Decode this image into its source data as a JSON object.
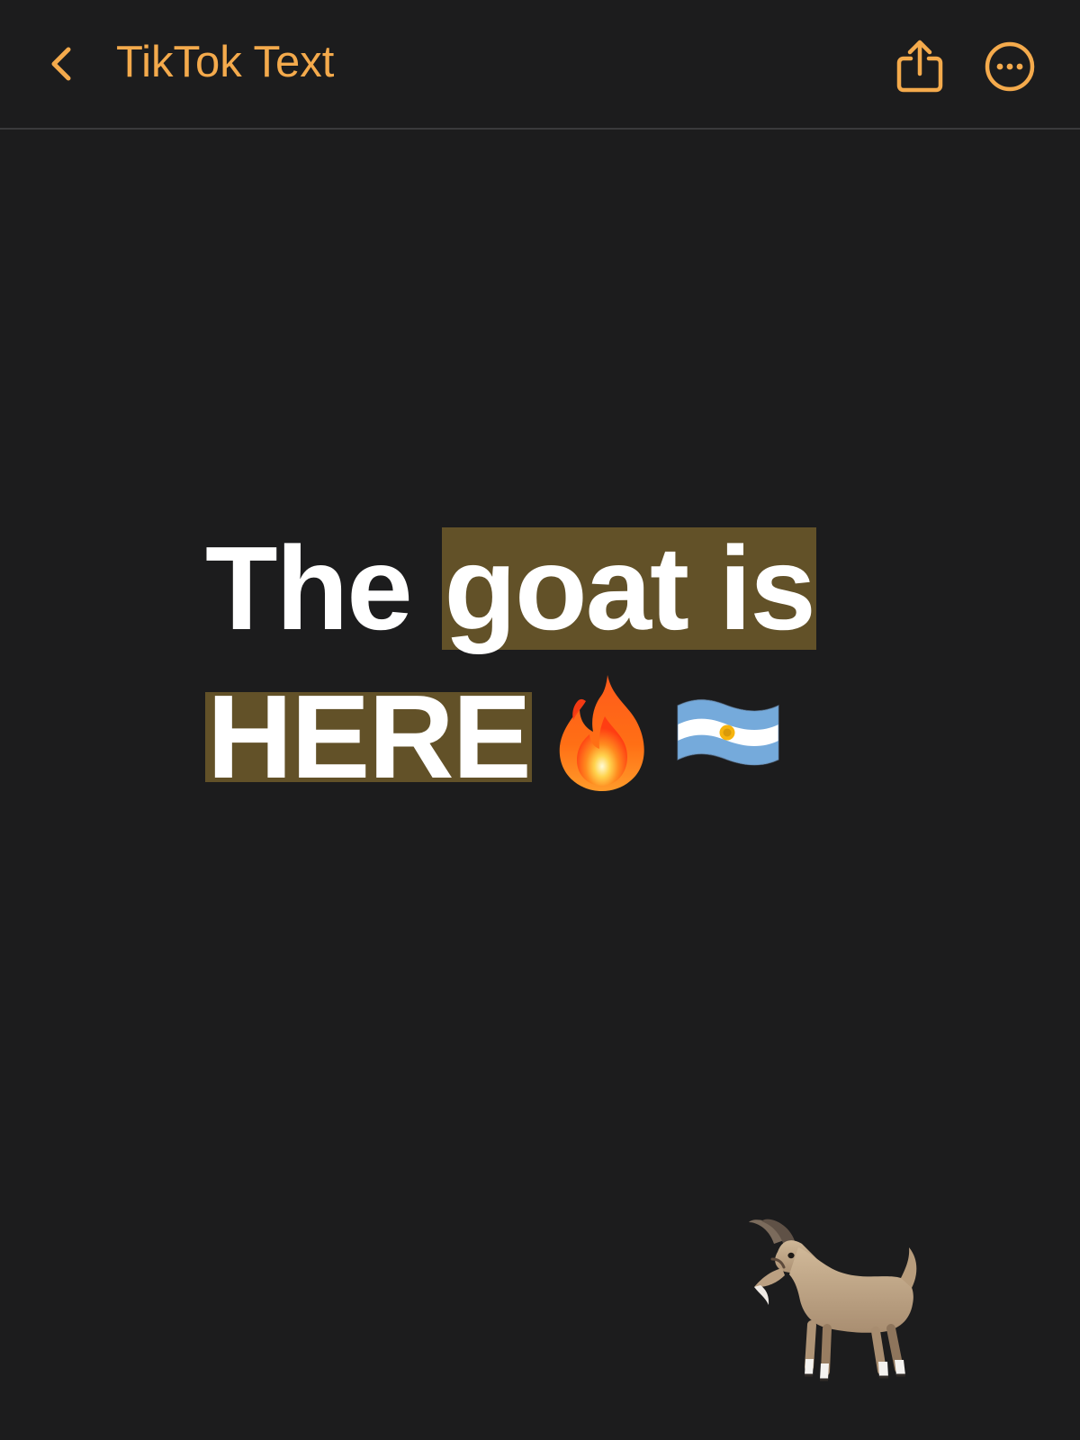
{
  "navbar": {
    "back_icon": "chevron-left-icon",
    "title": "TikTok Text",
    "share_icon": "share-icon",
    "more_icon": "ellipsis-circle-icon"
  },
  "note": {
    "line1_plain": "The",
    "line1_highlight": "goat is",
    "line2_highlight": "HERE",
    "line2_emojis": [
      "fire-icon",
      "argentina-flag-icon"
    ],
    "footer_emoji": "goat-icon"
  },
  "colors": {
    "accent": "#f4aa4c",
    "background": "#1c1c1d",
    "text": "#ffffff",
    "highlight": "#625128",
    "divider": "#3a3a3c"
  }
}
